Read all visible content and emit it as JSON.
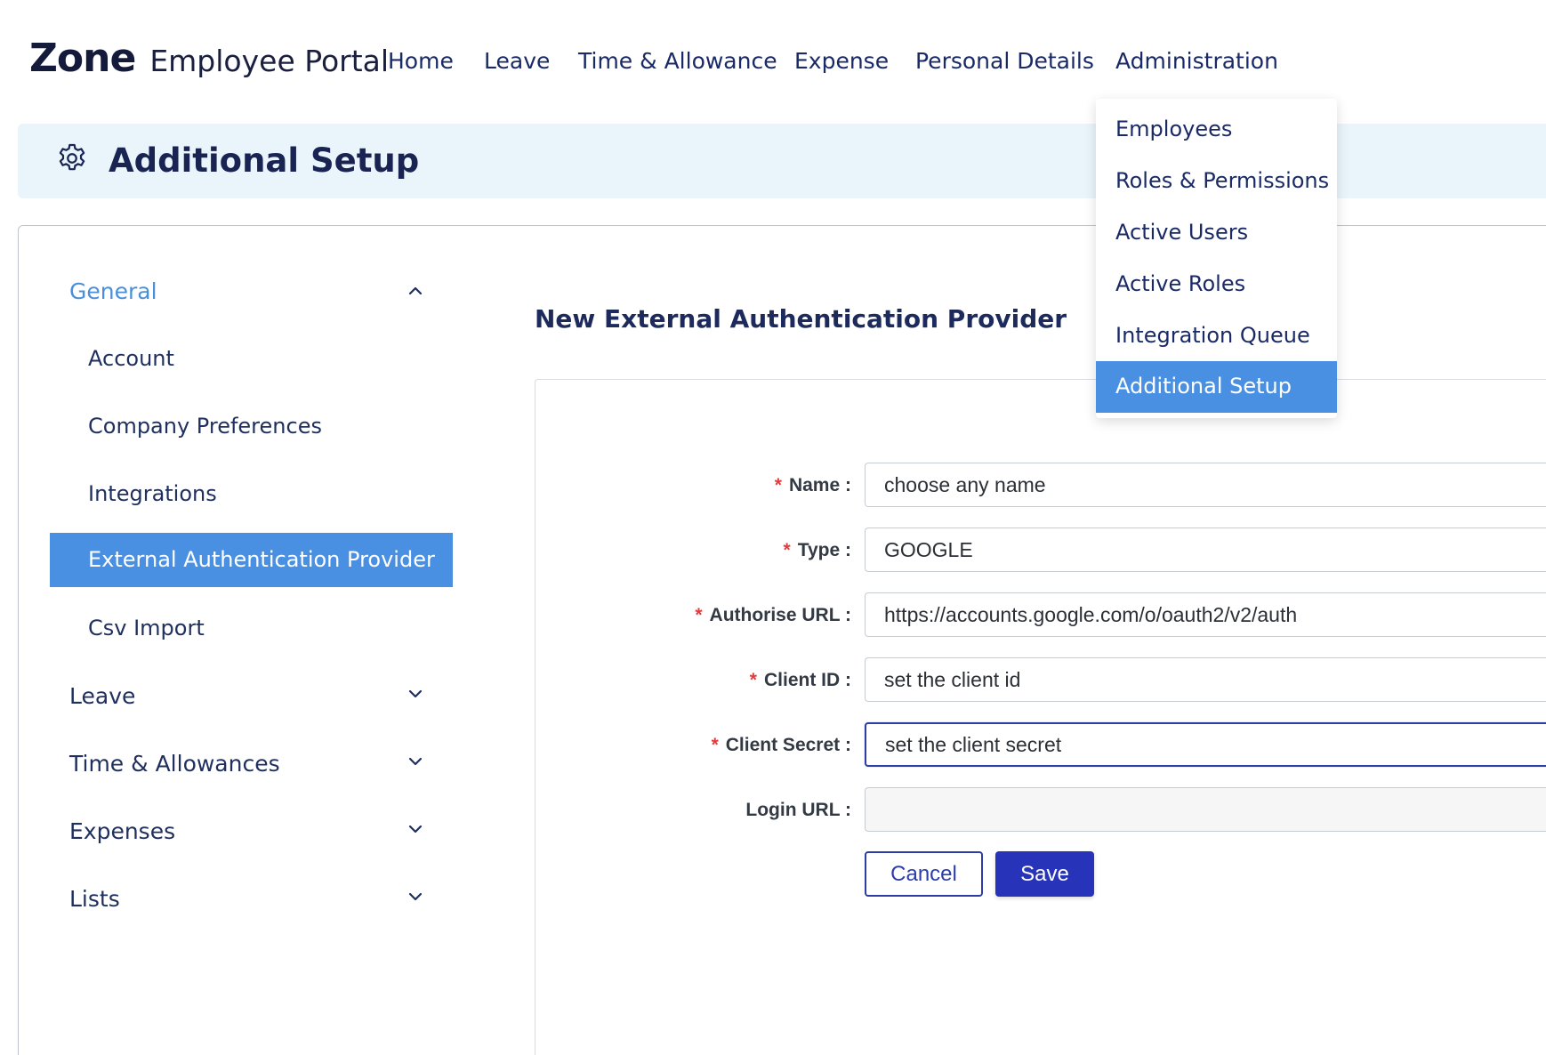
{
  "brand": {
    "logo": "Zone",
    "title": "Employee Portal"
  },
  "nav": {
    "items": [
      "Home",
      "Leave",
      "Time & Allowance",
      "Expense",
      "Personal Details",
      "Administration"
    ]
  },
  "admin_menu": {
    "items": [
      "Employees",
      "Roles & Permissions",
      "Active Users",
      "Active Roles",
      "Integration Queue",
      "Additional Setup"
    ],
    "active": "Additional Setup"
  },
  "page": {
    "title": "Additional Setup",
    "icon": "gear-icon"
  },
  "sidebar": {
    "general": {
      "label": "General",
      "expanded": true,
      "items": [
        "Account",
        "Company Preferences",
        "Integrations",
        "External Authentication Provider",
        "Csv Import"
      ],
      "active": "External Authentication Provider"
    },
    "groups": [
      "Leave",
      "Time & Allowances",
      "Expenses",
      "Lists"
    ]
  },
  "form": {
    "title": "New External Authentication Provider",
    "fields": {
      "name": {
        "label": "Name",
        "value": "choose any name",
        "required": true
      },
      "type": {
        "label": "Type",
        "value": "GOOGLE",
        "required": true
      },
      "authorise_url": {
        "label": "Authorise URL",
        "value": "https://accounts.google.com/o/oauth2/v2/auth",
        "required": true
      },
      "client_id": {
        "label": "Client ID",
        "value": "set the client id",
        "required": true
      },
      "client_secret": {
        "label": "Client Secret",
        "value": "set the client secret",
        "required": true
      },
      "login_url": {
        "label": "Login URL",
        "value": "",
        "required": false
      }
    },
    "required_mark": "*",
    "label_suffix": ":",
    "cancel_label": "Cancel",
    "save_label": "Save"
  },
  "colors": {
    "accent": "#4a90e2",
    "primary_button": "#2733b8",
    "header_bg": "#e9f5fb",
    "required": "#e23b3b",
    "link_active": "#4a90d9"
  }
}
